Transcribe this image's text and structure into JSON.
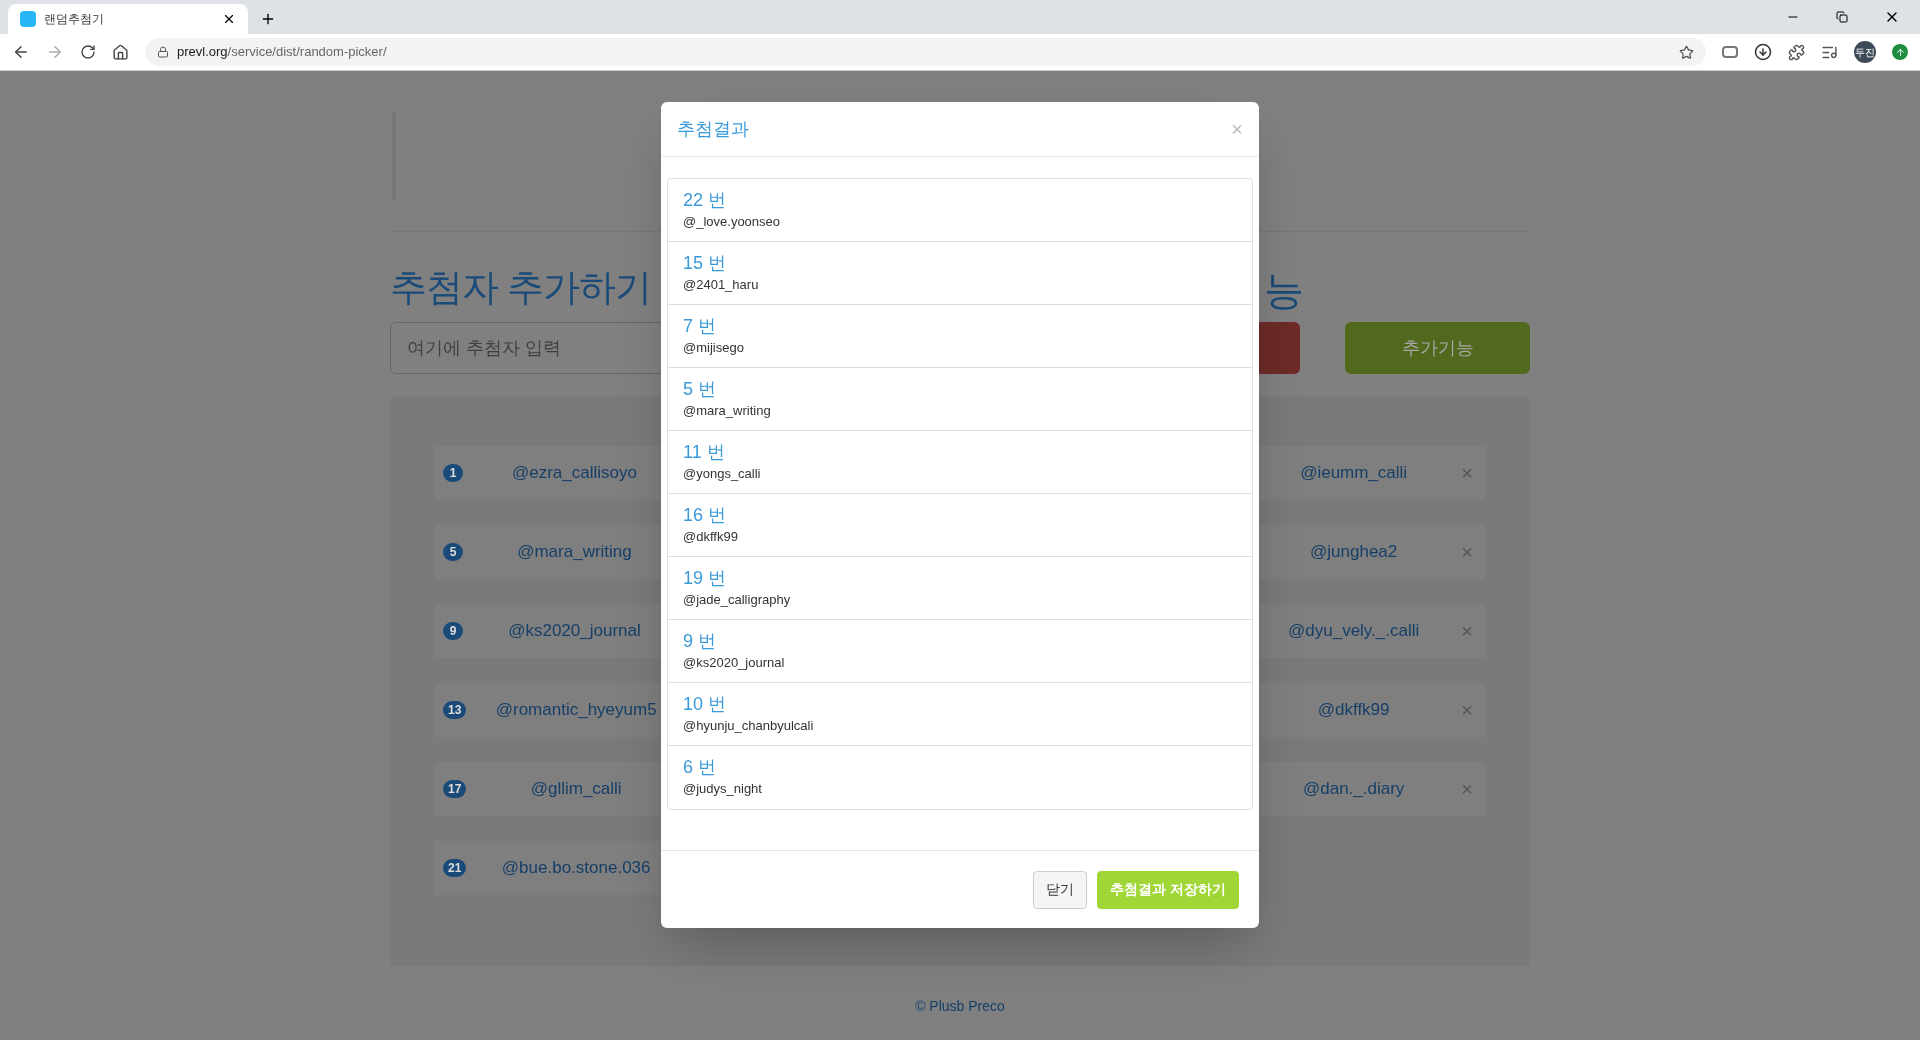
{
  "browser": {
    "tab_title": "랜덤추첨기",
    "url_host": "prevl.org",
    "url_path": "/service/dist/random-picker/",
    "profile": "두진"
  },
  "page": {
    "heading_left": "추첨자 추가하기",
    "heading_right": "능",
    "input_placeholder": "여기에 추첨자 입력",
    "extra_button": "추가기능",
    "left_column": [
      {
        "number": "1",
        "handle": "@ezra_callisoyo"
      },
      {
        "number": "5",
        "handle": "@mara_writing"
      },
      {
        "number": "9",
        "handle": "@ks2020_journal"
      },
      {
        "number": "13",
        "handle": "@romantic_hyeyum5"
      },
      {
        "number": "17",
        "handle": "@gllim_calli"
      },
      {
        "number": "21",
        "handle": "@bue.bo.stone.036"
      }
    ],
    "right_column": [
      {
        "handle": "@ieumm_calli",
        "remove": "×"
      },
      {
        "handle": "@junghea2",
        "remove": "×"
      },
      {
        "handle": "@dyu_vely._.calli",
        "remove": "×"
      },
      {
        "handle": "@dkffk99",
        "remove": "×"
      },
      {
        "handle": "@dan._.diary",
        "remove": "×"
      }
    ],
    "footer": "© Plusb Preco"
  },
  "modal": {
    "title": "추첨결과",
    "close": "×",
    "results": [
      {
        "number": "22 번",
        "handle": "@_love.yoonseo"
      },
      {
        "number": "15 번",
        "handle": "@2401_haru"
      },
      {
        "number": "7 번",
        "handle": "@mijisego"
      },
      {
        "number": "5 번",
        "handle": "@mara_writing"
      },
      {
        "number": "11 번",
        "handle": "@yongs_calli"
      },
      {
        "number": "16 번",
        "handle": "@dkffk99"
      },
      {
        "number": "19 번",
        "handle": "@jade_calligraphy"
      },
      {
        "number": "9 번",
        "handle": "@ks2020_journal"
      },
      {
        "number": "10 번",
        "handle": "@hyunju_chanbyulcali"
      },
      {
        "number": "6 번",
        "handle": "@judys_night"
      }
    ],
    "buttons": [
      {
        "kind": "default",
        "label": "닫기"
      },
      {
        "kind": "primary",
        "label": "추첨결과 저장하기"
      }
    ]
  }
}
